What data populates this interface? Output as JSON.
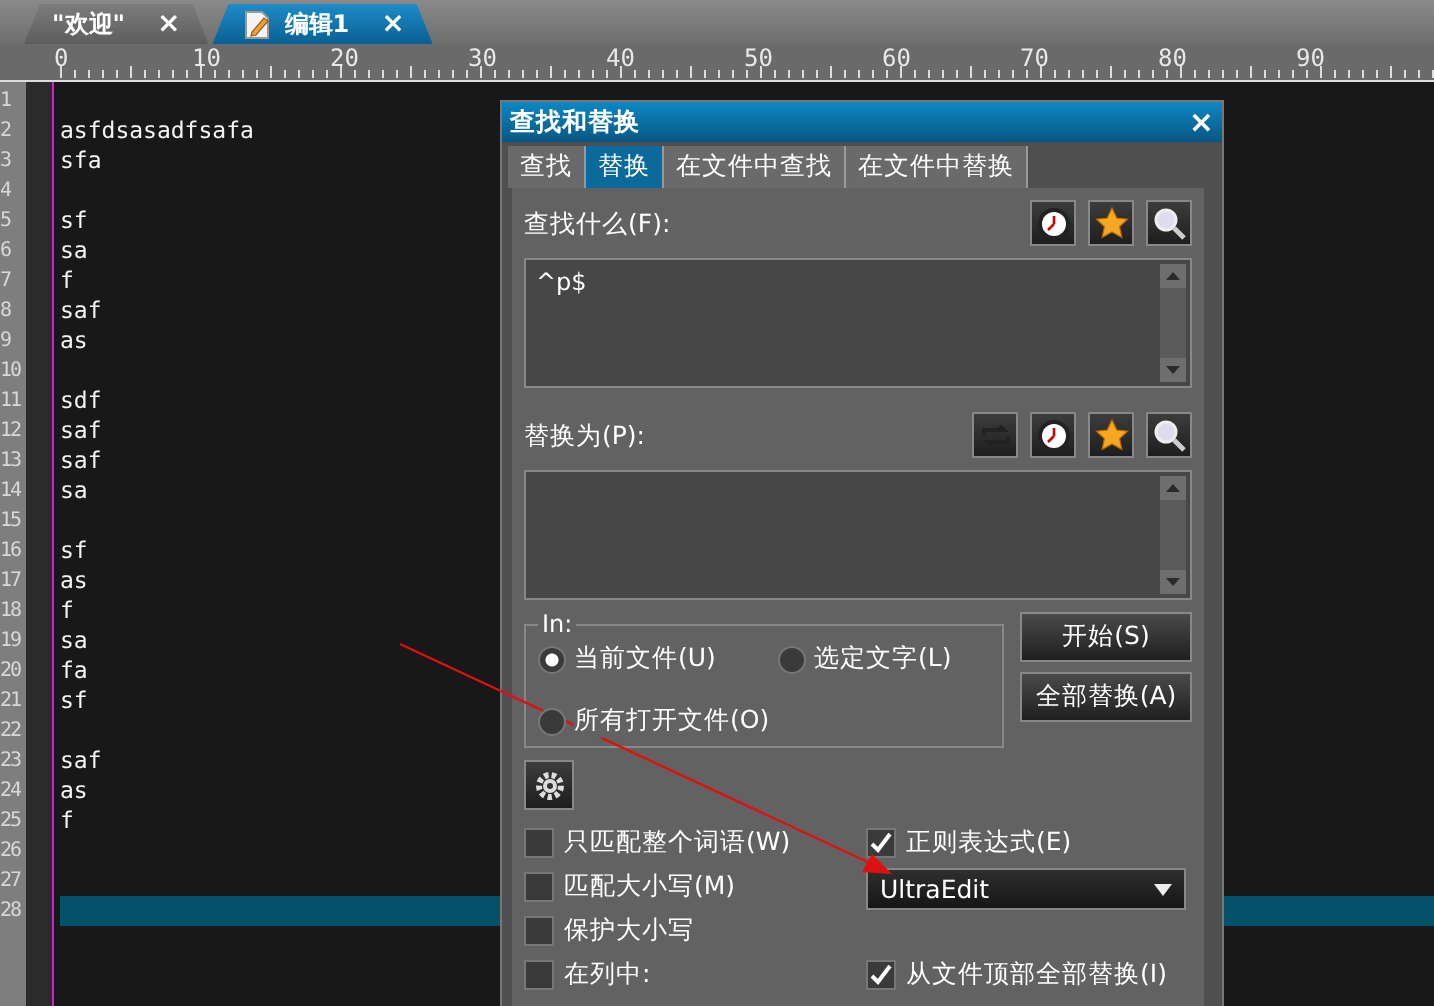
{
  "tabs": [
    {
      "kind": "welcome",
      "label": "\"欢迎\"",
      "close": "×",
      "selected": false
    },
    {
      "kind": "document",
      "label": "编辑1",
      "close": "×",
      "selected": true
    }
  ],
  "ruler": [
    "0",
    "10",
    "20",
    "30",
    "40",
    "50",
    "60",
    "70",
    "80",
    "90"
  ],
  "editor": {
    "lines": [
      {
        "number": "1",
        "current": false
      },
      {
        "number": "2",
        "text": "asfdsasadfsafa",
        "current": false
      },
      {
        "number": "3",
        "text": "sfa",
        "current": false
      },
      {
        "number": "4",
        "current": false
      },
      {
        "number": "5",
        "text": "sf",
        "current": false
      },
      {
        "number": "6",
        "text": "sa",
        "current": false
      },
      {
        "number": "7",
        "text": "f",
        "current": false
      },
      {
        "number": "8",
        "text": "saf",
        "current": false
      },
      {
        "number": "9",
        "text": "as",
        "current": false
      },
      {
        "number": "10",
        "current": false
      },
      {
        "number": "11",
        "text": "sdf",
        "current": false
      },
      {
        "number": "12",
        "text": "saf",
        "current": false
      },
      {
        "number": "13",
        "text": "saf",
        "current": false
      },
      {
        "number": "14",
        "text": "sa",
        "current": false
      },
      {
        "number": "15",
        "current": false
      },
      {
        "number": "16",
        "text": "sf",
        "current": false
      },
      {
        "number": "17",
        "text": "as",
        "current": false
      },
      {
        "number": "18",
        "text": "f",
        "current": false
      },
      {
        "number": "19",
        "text": "sa",
        "current": false
      },
      {
        "number": "20",
        "text": "fa",
        "current": false
      },
      {
        "number": "21",
        "text": "sf",
        "current": false
      },
      {
        "number": "22",
        "current": false
      },
      {
        "number": "23",
        "text": "saf",
        "current": false
      },
      {
        "number": "24",
        "text": "as",
        "current": false
      },
      {
        "number": "25",
        "text": "f",
        "current": false
      },
      {
        "number": "26",
        "current": false
      },
      {
        "number": "27",
        "current": false
      },
      {
        "number": "28",
        "current": true
      }
    ]
  },
  "dialog": {
    "title": "查找和替换",
    "close": "×",
    "tabs": [
      {
        "label": "查找",
        "selected": false
      },
      {
        "label": "替换",
        "selected": true
      },
      {
        "label": "在文件中查找",
        "selected": false
      },
      {
        "label": "在文件中替换",
        "selected": false
      }
    ],
    "find_label": "查找什么(F):",
    "find_value": "^p$",
    "replace_label": "替换为(P):",
    "scope": {
      "legend": "In:",
      "options": [
        {
          "label": "当前文件(U)",
          "selected": true
        },
        {
          "label": "选定文字(L)",
          "selected": false
        },
        {
          "label": "所有打开文件(O)",
          "selected": false
        }
      ]
    },
    "buttons": [
      "开始(S)",
      "全部替换(A)"
    ],
    "left_options": [
      {
        "label": "只匹配整个词语(W)",
        "checked": false
      },
      {
        "label": "匹配大小写(M)",
        "checked": false
      },
      {
        "label": "保护大小写",
        "checked": false
      },
      {
        "label": "在列中:",
        "checked": false
      }
    ],
    "right_options": [
      {
        "kind": "checkbox",
        "label": "正则表达式(E)",
        "checked": true
      },
      {
        "kind": "dropdown",
        "value": "UltraEdit"
      },
      {
        "kind": "checkbox",
        "label": "从文件顶部全部替换(I)",
        "checked": true
      }
    ]
  }
}
